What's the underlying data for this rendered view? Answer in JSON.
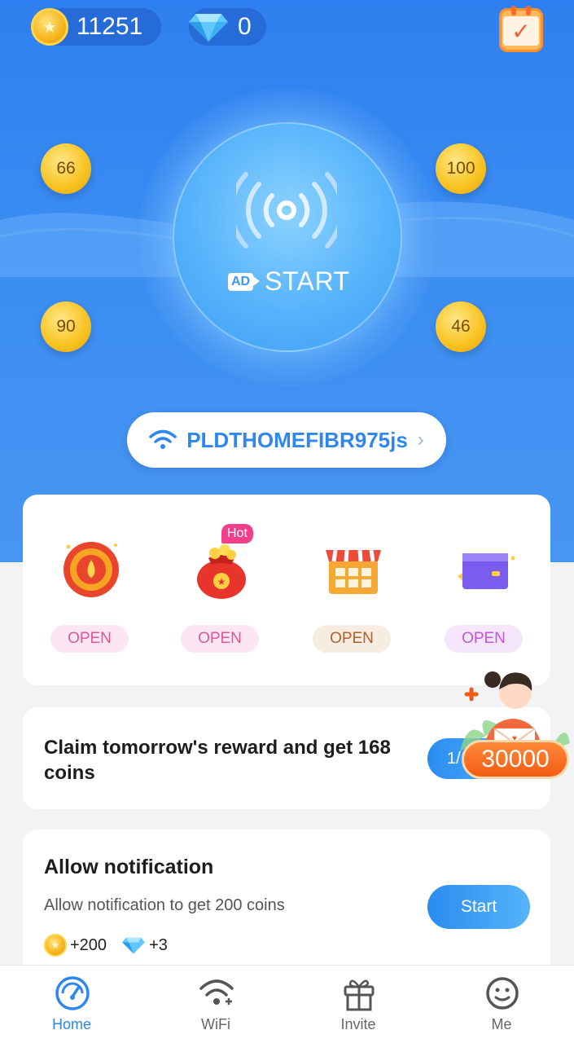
{
  "header": {
    "coins": "11251",
    "gems": "0",
    "coin_icon": "coin-icon",
    "gem_icon": "diamond-icon",
    "calendar_icon": "calendar-check-icon"
  },
  "bubbles": [
    {
      "value": "66"
    },
    {
      "value": "100"
    },
    {
      "value": "90"
    },
    {
      "value": "46"
    }
  ],
  "main_button": {
    "ad_badge": "AD",
    "label": "START"
  },
  "wifi": {
    "name": "PLDTHOMEFIBR975js",
    "chevron": "›"
  },
  "tools": [
    {
      "icon": "spin-wheel-icon",
      "label": "OPEN",
      "bg": "#fbe6f2",
      "color": "#e0569a"
    },
    {
      "icon": "lucky-bag-icon",
      "label": "OPEN",
      "bg": "#fbe6f2",
      "color": "#e0569a",
      "hot": "Hot"
    },
    {
      "icon": "shop-stall-icon",
      "label": "OPEN",
      "bg": "#f7ece2",
      "color": "#b0602a"
    },
    {
      "icon": "mystery-box-icon",
      "label": "OPEN",
      "bg": "#f6e6fb",
      "color": "#c056d8"
    }
  ],
  "claim": {
    "text": "Claim tomorrow's reward and get 168 coins",
    "button_partial": "1/"
  },
  "promo": {
    "amount": "30000",
    "icon": "girl-envelope-promo-icon"
  },
  "notification": {
    "title": "Allow notification",
    "description": "Allow notification to get 200 coins",
    "button": "Start",
    "coin_reward": "+200",
    "gem_reward": "+3"
  },
  "nav": {
    "items": [
      {
        "label": "Home",
        "icon": "speedometer-icon",
        "active": true
      },
      {
        "label": "WiFi",
        "icon": "wifi-icon",
        "active": false
      },
      {
        "label": "Invite",
        "icon": "gift-icon",
        "active": false
      },
      {
        "label": "Me",
        "icon": "smiley-icon",
        "active": false
      }
    ]
  },
  "colors": {
    "primary": "#2e86ef",
    "accent_orange": "#f25b14"
  }
}
